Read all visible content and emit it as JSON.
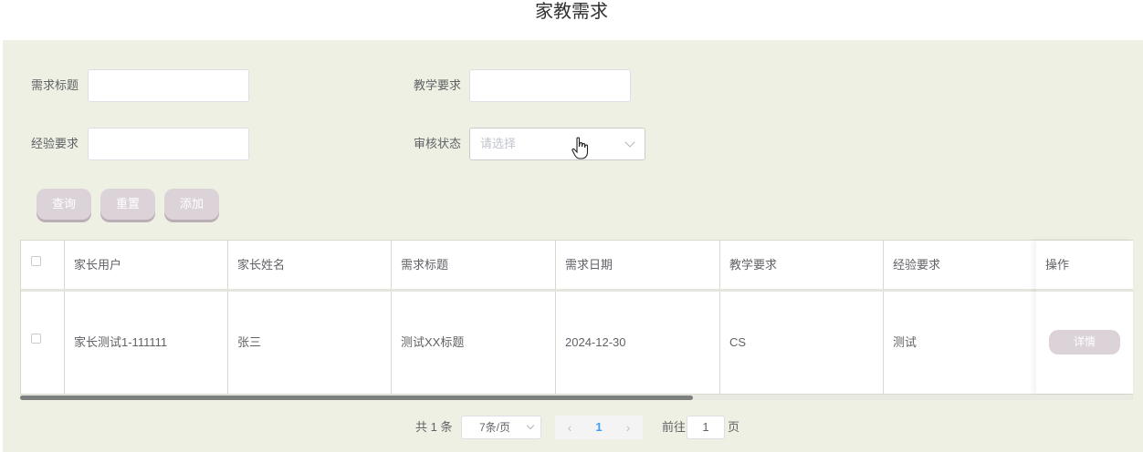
{
  "page": {
    "title": "家教需求"
  },
  "search": {
    "title_label": "需求标题",
    "title_value": "",
    "teach_label": "教学要求",
    "teach_value": "",
    "exp_label": "经验要求",
    "exp_value": "",
    "status_label": "审核状态",
    "status_placeholder": "请选择"
  },
  "actions": {
    "query": "查询",
    "reset": "重置",
    "add": "添加"
  },
  "table": {
    "columns": [
      "家长用户",
      "家长姓名",
      "需求标题",
      "需求日期",
      "教学要求",
      "经验要求",
      "操作"
    ],
    "rows": [
      {
        "cells": [
          "家长测试1-111111",
          "张三",
          "测试XX标题",
          "2024-12-30",
          "CS",
          "测试"
        ],
        "action": "详情"
      }
    ]
  },
  "pagination": {
    "total": "共 1 条",
    "page_size": "7条/页",
    "prev": "‹",
    "current": "1",
    "next": "›",
    "goto_prefix": "前往",
    "goto_value": "1",
    "goto_suffix": "页"
  },
  "colors": {
    "panel": "#edf0e2",
    "button": "#dcd3d9",
    "accent": "#409eff"
  }
}
